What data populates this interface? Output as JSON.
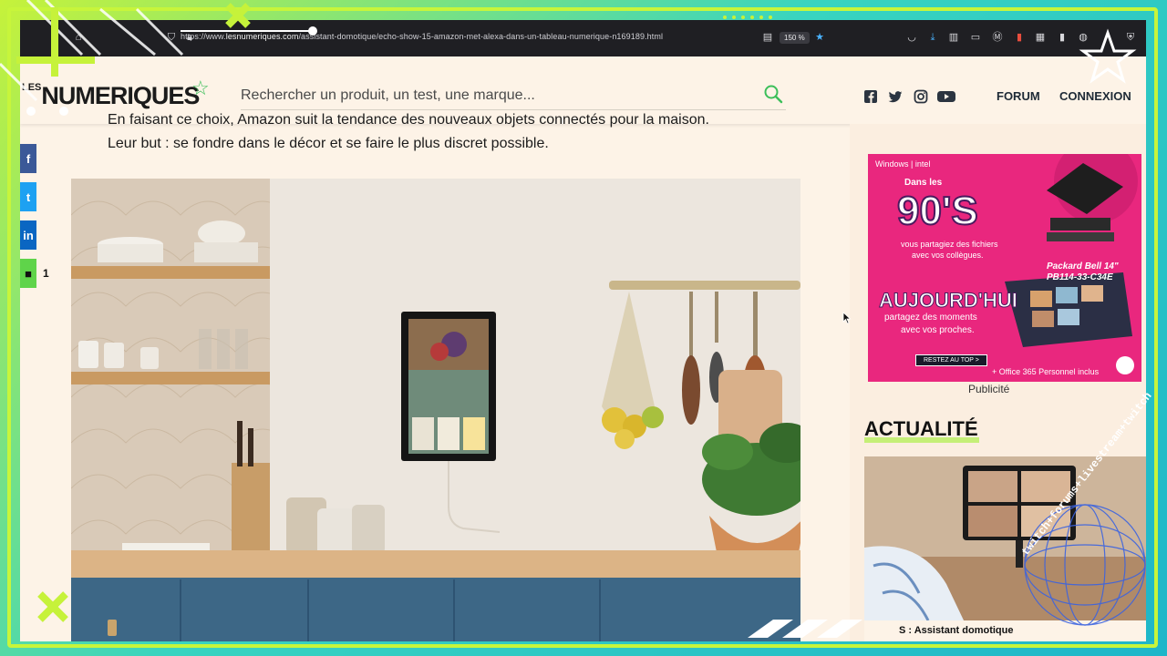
{
  "browser": {
    "url_prefix": "https://www.",
    "url_domain": "lesnumeriques.com",
    "url_path": "/assistant-domotique/echo-show-15-amazon-met-alexa-dans-un-tableau-numerique-n169189.html",
    "zoom": "150 %"
  },
  "site": {
    "logo_prefix": "LES",
    "logo": "NUMERIQUES",
    "search_placeholder": "Rechercher un produit, un test, une marque...",
    "nav": {
      "forum": "FORUM",
      "connexion": "CONNEXION"
    },
    "social": [
      "facebook-icon",
      "twitter-icon",
      "instagram-icon",
      "youtube-icon"
    ]
  },
  "article": {
    "paragraph_1": "En faisant ce choix, Amazon suit la tendance des nouveaux objets connectés pour la maison.",
    "paragraph_2": "Leur but : se fondre dans le décor et se faire le plus discret possible."
  },
  "share": {
    "facebook": "f",
    "twitter": "t",
    "linkedin": "in",
    "comments": "1"
  },
  "ad": {
    "brands": "Windows | intel",
    "headline_small": "Dans les",
    "headline_big": "90'S",
    "line1": "vous partagiez des fichiers",
    "line2": "avec vos collègues.",
    "product": "Packard Bell 14\"",
    "model": "PB114-33-C34E",
    "today": "AUJOURD'HUI",
    "line3": "partagez des moments",
    "line4": "avec vos proches.",
    "cta": "RESTEZ AU TOP >",
    "office": "+ Office 365 Personnel inclus",
    "label": "Publicité"
  },
  "sidebar": {
    "section_title": "ACTUALITÉ",
    "news_caption": "S : Assistant domotique"
  },
  "overlay": {
    "ring_text": "twitch+forums+livestream+twitch"
  },
  "colors": {
    "frame_green": "#c7f53b",
    "frame_teal": "#2fc8b8",
    "page_bg": "#fdf3e7",
    "accent_green": "#3cbf5a",
    "facebook": "#3b5998",
    "twitter": "#1da1f2",
    "linkedin": "#0a66c2",
    "comment": "#5fd44a",
    "ad_pink": "#e9277e"
  }
}
